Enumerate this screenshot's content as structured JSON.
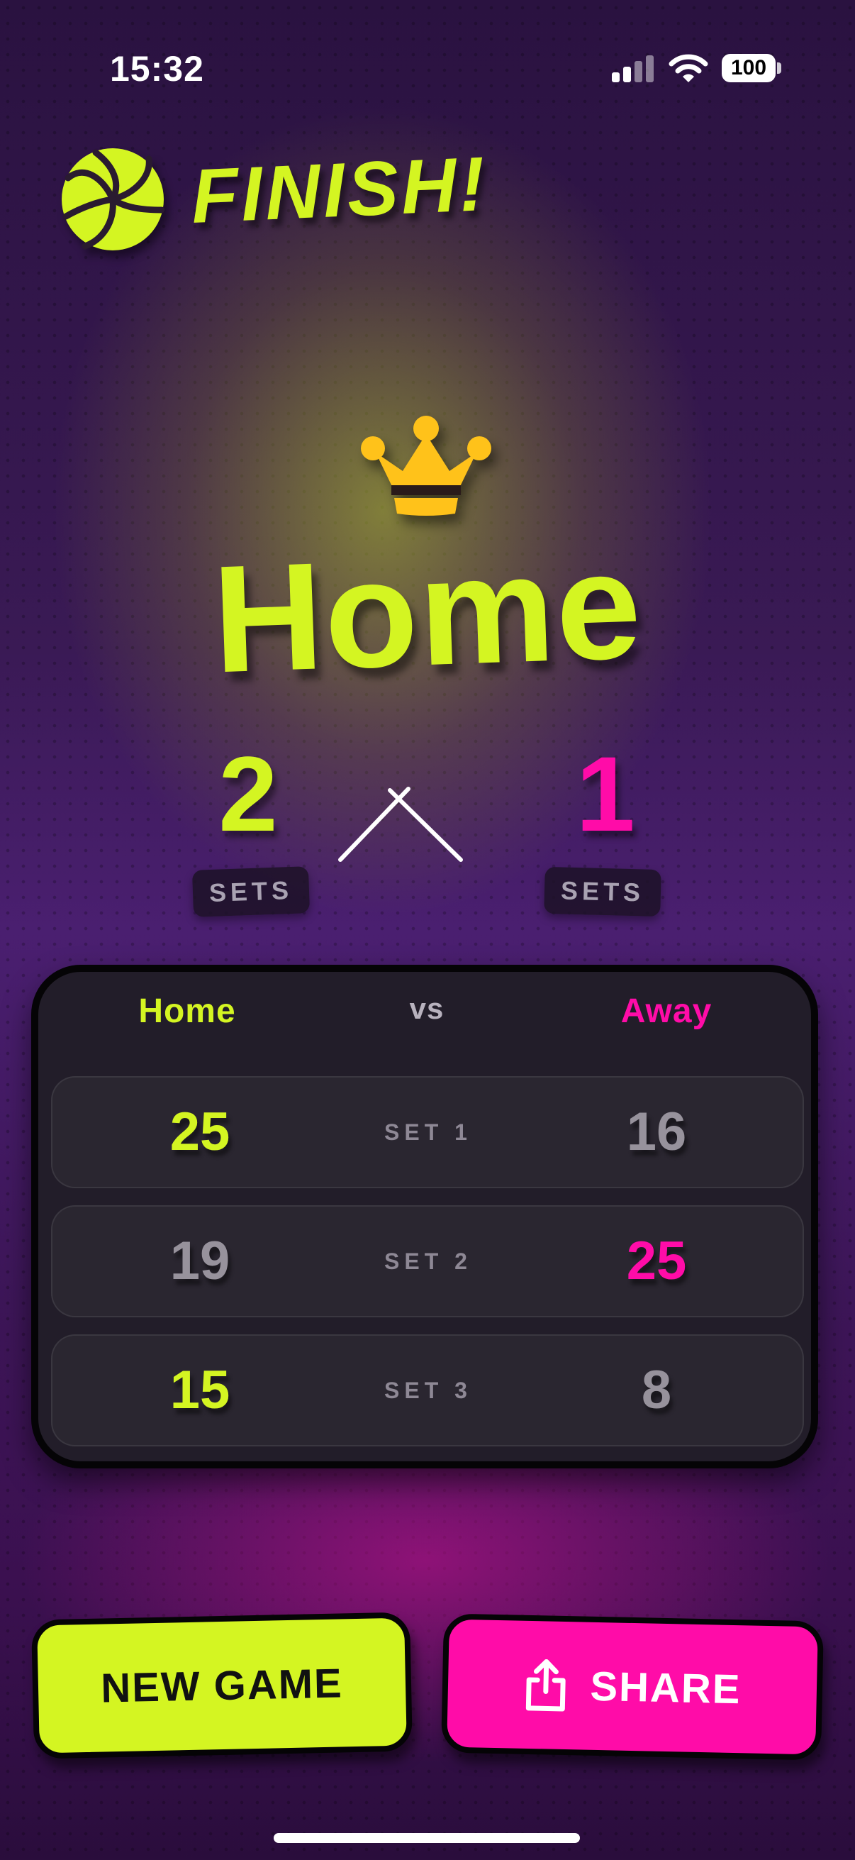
{
  "status_bar": {
    "time": "15:32",
    "battery": "100"
  },
  "header": {
    "title": "FINISH!",
    "icon": "volleyball-icon"
  },
  "winner": {
    "icon": "crown-icon",
    "name": "Home"
  },
  "sets": {
    "home": {
      "value": "2",
      "label": "SETS"
    },
    "away": {
      "value": "1",
      "label": "SETS"
    }
  },
  "scoreboard": {
    "columns": {
      "home": "Home",
      "vs": "vs",
      "away": "Away"
    },
    "rows": [
      {
        "label": "SET 1",
        "home": "25",
        "away": "16",
        "winner": "home"
      },
      {
        "label": "SET 2",
        "home": "19",
        "away": "25",
        "winner": "away"
      },
      {
        "label": "SET 3",
        "home": "15",
        "away": "8",
        "winner": "home"
      }
    ]
  },
  "actions": {
    "new_game": "NEW GAME",
    "share": "SHARE",
    "share_icon": "share-icon"
  },
  "colors": {
    "home_accent": "#d4f522",
    "away_accent": "#ff0ca8",
    "crown": "#ffc21a"
  }
}
